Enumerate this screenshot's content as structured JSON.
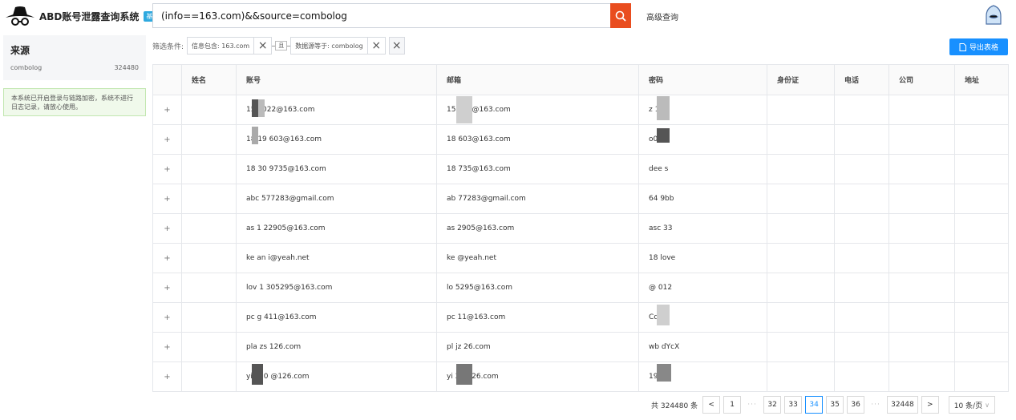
{
  "header": {
    "app_title": "ABD账号泄露查询系统",
    "badge": "基础版",
    "search_value": "(info==163.com)&&source=combolog",
    "advanced_link": "高级查询"
  },
  "sidebar": {
    "source_title": "来源",
    "source_name": "combolog",
    "source_count": "324480",
    "notice": "本系统已开启登录与链路加密，系统不进行日志记录，请放心使用。"
  },
  "filter": {
    "label": "筛选条件:",
    "chip1": "信息包含: 163.com",
    "connector": "且",
    "chip2": "数据源等于: combolog"
  },
  "toolbar": {
    "export_label": "导出表格"
  },
  "table": {
    "columns": [
      "",
      "姓名",
      "账号",
      "邮箱",
      "密码",
      "身份证",
      "电话",
      "公司",
      "地址"
    ],
    "rows": [
      {
        "expand": "+",
        "name": "",
        "account": "159    022@163.com",
        "email": "15        022@163.com",
        "password": "z          123"
      },
      {
        "expand": "+",
        "name": "",
        "account": "18    19   603@163.com",
        "email": "18          603@163.com",
        "password": "o0c"
      },
      {
        "expand": "+",
        "name": "",
        "account": "18    30   9735@163.com",
        "email": "18         735@163.com",
        "password": "dee        s"
      },
      {
        "expand": "+",
        "name": "",
        "account": "abc    577283@gmail.com",
        "email": "ab        77283@gmail.com",
        "password": "64         9bb"
      },
      {
        "expand": "+",
        "name": "",
        "account": "as    1   22905@163.com",
        "email": "as         2905@163.com",
        "password": "asc        33"
      },
      {
        "expand": "+",
        "name": "",
        "account": "ke    an   i@yeah.net",
        "email": "ke         @yeah.net",
        "password": "18            love"
      },
      {
        "expand": "+",
        "name": "",
        "account": "lov    1  305295@163.com",
        "email": "lo          5295@163.com",
        "password": "@           012"
      },
      {
        "expand": "+",
        "name": "",
        "account": "pc    g    411@163.com",
        "email": "pc           11@163.com",
        "password": "Cc          11"
      },
      {
        "expand": "+",
        "name": "",
        "account": "pla    zs   126.com",
        "email": "pl     jz     26.com",
        "password": "wb           dYcX"
      },
      {
        "expand": "+",
        "name": "",
        "account": "yiy    g0   @126.com",
        "email": "yi           2@126.com",
        "password": "19         12"
      }
    ]
  },
  "pagination": {
    "total": "共 324480 条",
    "prev": "<",
    "first": "1",
    "pages": [
      "32",
      "33",
      "34",
      "35",
      "36"
    ],
    "active": "34",
    "last": "32448",
    "next": ">",
    "page_size": "10 条/页"
  },
  "colors": {
    "accent": "#1890ff",
    "search_button": "#e94d1f",
    "notice_bg": "#f0f9eb",
    "badge": "#2ea9df"
  }
}
